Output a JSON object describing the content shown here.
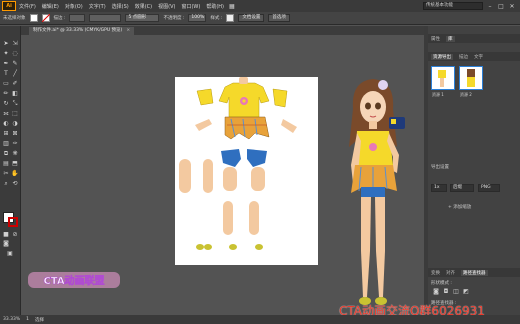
{
  "app": {
    "logo_text": "Ai",
    "menus": [
      "文件(F)",
      "编辑(E)",
      "对象(O)",
      "文字(T)",
      "选择(S)",
      "效果(C)",
      "视图(V)",
      "窗口(W)",
      "帮助(H)"
    ],
    "workspace": "传统基本功能",
    "window_controls": [
      "–",
      "□",
      "✕"
    ]
  },
  "control_bar": {
    "object_label": "未选择对象",
    "stroke_label": "描边 :",
    "brush_label": "5 点圆形",
    "opacity_label": "不透明度 :",
    "opacity_value": "100%",
    "style_label": "样式 :",
    "doc_setup_label": "文档设置",
    "preferences_label": "首选项"
  },
  "document_tab": {
    "label": "制作文件.ai* @ 33.33% (CMYK/GPU 预览)",
    "close": "×"
  },
  "right_panel": {
    "top_tabs": [
      "属性",
      "库"
    ],
    "sub_tabs": [
      "资源导出",
      "描边",
      "文字"
    ],
    "assets": [
      {
        "label": "资源 1"
      },
      {
        "label": "资源 2"
      }
    ],
    "export_settings_label": "导出设置",
    "scale_value": "1x",
    "suffix_value": "后缀",
    "format_value": "PNG",
    "add_scale_label": "+ 添加缩放",
    "bottom_tabs": [
      "变换",
      "对齐",
      "路径查找器"
    ],
    "shape_mode_label": "形状模式 :",
    "pathfinder_label": "路径查找器 :"
  },
  "status": {
    "zoom": "33.33%",
    "page": "1",
    "mode": "选择"
  },
  "watermark": {
    "logo_text": "CTA动画联盟",
    "footer_text": "CTA动画交流Q群6026931"
  },
  "colors": {
    "accent": "#2b7fd6",
    "watermark_red": "#e8392b",
    "fill": "#ffffff",
    "stroke": "#cc0000"
  }
}
